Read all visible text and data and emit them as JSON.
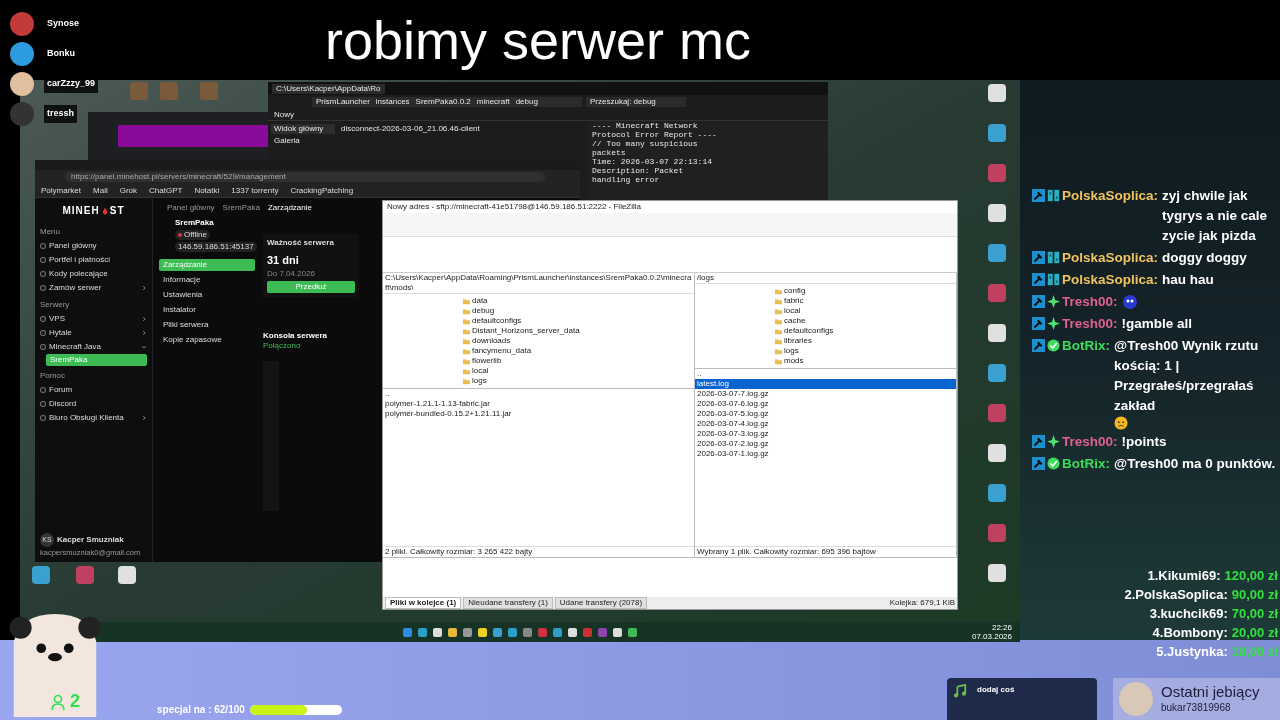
{
  "title": "robimy serwer mc",
  "viewers": [
    {
      "name": "Synose",
      "color": "#c23a3a"
    },
    {
      "name": "Bonku",
      "color": "#2d9be0"
    },
    {
      "name": "carZzzy_99",
      "color": "#e0c0a0"
    },
    {
      "name": "tressh",
      "color": "#333333"
    }
  ],
  "chat": [
    {
      "kind": "bg",
      "user": "PolskaSoplica:",
      "color": "#f0c45c",
      "text": "zyj chwile jak tygrys a nie cale zycie jak pizda"
    },
    {
      "kind": "bg",
      "user": "PolskaSoplica:",
      "color": "#f0c45c",
      "text": "doggy doggy"
    },
    {
      "kind": "bg",
      "user": "PolskaSoplica:",
      "color": "#f0c45c",
      "text": "hau hau"
    },
    {
      "kind": "sparkle",
      "user": "Tresh00:",
      "color": "#e0628f",
      "emote": true
    },
    {
      "kind": "sparkle",
      "user": "Tresh00:",
      "color": "#e0628f",
      "text": "!gamble all"
    },
    {
      "kind": "verified",
      "user": "BotRix:",
      "color": "#3ddc5a",
      "text": "@Tresh00 Wynik rzutu kością: 1 | Przegrałeś/przegrałaś zakład",
      "emoji": true
    },
    {
      "kind": "sparkle",
      "user": "Tresh00:",
      "color": "#e0628f",
      "text": "!points"
    },
    {
      "kind": "verified",
      "user": "BotRix:",
      "color": "#3ddc5a",
      "text": "@Tresh00 ma 0 punktów."
    }
  ],
  "leaderboard": [
    {
      "entry": "1.Kikumi69:",
      "amount": "120,00 zł"
    },
    {
      "entry": "2.PolskaSoplica:",
      "amount": "90,00 zł"
    },
    {
      "entry": "3.kuchcik69:",
      "amount": "70,00 zł"
    },
    {
      "entry": "4.Bombony:",
      "amount": "20,00 zł"
    },
    {
      "entry": "5.Justynka:",
      "amount": "18,00 zł"
    }
  ],
  "viewer_count": "2",
  "goal": {
    "label": "specjal na : 62/100",
    "level": 0.62
  },
  "music_widget": {
    "title": "dodaj coś"
  },
  "last_follower": {
    "title": "Ostatni jebiący",
    "name": "bukar73819968"
  },
  "explorer": {
    "tab": "C:\\Users\\Kacper\\AppData\\Ro",
    "path": [
      "PrismLauncher",
      "instances",
      "SremPaka0.0.2",
      "minecraft",
      "debug"
    ],
    "search": "Przeszukaj: debug",
    "new_button": "Nowy",
    "sidebar": [
      "Widok główny",
      "Galeria"
    ],
    "file": "disconnect-2026-03-06_21.06.46-client",
    "preview": "---- Minecraft Network\nProtocol Error Report ----\n// Too many suspicious\npackets\nTime: 2026-03-07 22:13:14\nDescription: Packet\nhandling error"
  },
  "browser": {
    "url": "https://panel.minehost.pl/servers/minecraft/529/management",
    "bookmarks": [
      "Polymarket",
      "Mail",
      "Grok",
      "ChatGPT",
      "Notatki",
      "1337 torrenty",
      "CrackingPatching"
    ],
    "logo_left": "MINEH",
    "logo_right": "ST",
    "breadcrumb": [
      "Panel główny",
      "SremPaka",
      "Zarządzanie"
    ],
    "server": {
      "name": "SremPaka",
      "status": "Offline",
      "online": false,
      "address": "146.59.186.51:45137"
    },
    "sections": [
      {
        "heading": "Menu",
        "items": [
          {
            "label": "Panel główny"
          },
          {
            "label": "Portfel i płatności"
          },
          {
            "label": "Kody polecające"
          },
          {
            "label": "Zamów serwer",
            "expanded": false
          }
        ]
      },
      {
        "heading": "Serwery",
        "items": [
          {
            "label": "VPS",
            "expanded": false
          },
          {
            "label": "Hytale",
            "expanded": false
          },
          {
            "label": "Minecraft Java",
            "expanded": true,
            "children": [
              {
                "label": "SremPaka",
                "selected": true
              }
            ]
          }
        ]
      },
      {
        "heading": "Pomoc",
        "items": [
          {
            "label": "Forum"
          },
          {
            "label": "Discord"
          },
          {
            "label": "Biuro Obsługi Klienta",
            "expanded": false
          }
        ]
      }
    ],
    "server_nav": [
      {
        "label": "Zarządzanie",
        "selected": true
      },
      {
        "label": "Informacje",
        "selected": false
      },
      {
        "label": "Ustawienia",
        "selected": false
      },
      {
        "label": "Instalator",
        "selected": false
      },
      {
        "label": "Pliki serwera",
        "selected": false
      },
      {
        "label": "Kopie zapasowe",
        "selected": false
      }
    ],
    "validity": {
      "title": "Ważność serwera",
      "days": "31 dni",
      "until": "Do 7.04.2026",
      "button": "Przedłuż"
    },
    "console": {
      "title": "Konsola serwera",
      "status": "Połączono"
    },
    "user": {
      "initials": "KS",
      "name": "Kacper Smuzniak",
      "email": "kacpersmuzniak0@gmail.com"
    }
  },
  "filezilla": {
    "title": "Nowy adres - sftp://minecraft-41e51798@146.59.186.51:2222 - FileZilla",
    "local_path": "C:\\Users\\Kacper\\AppData\\Roaming\\PrismLauncher\\instances\\SremPaka0.0.2\\minecraft\\mods\\",
    "remote_path": "/logs",
    "local_tree": [
      "data",
      "debug",
      "defaultconfigs",
      "Distant_Horizons_server_data",
      "downloads",
      "fancymenu_data",
      "flowerlib",
      "local",
      "logs"
    ],
    "remote_tree": [
      "config",
      "fabric",
      "local",
      "cache",
      "defaultconfigs",
      "libraries",
      "logs",
      "mods"
    ],
    "local_files": [
      {
        "name": "..",
        "selected": false
      },
      {
        "name": "polymer-1.21.1-1.13-fabric.jar",
        "selected": false
      },
      {
        "name": "polymer-bundled-0.15.2+1.21.11.jar",
        "selected": false
      }
    ],
    "remote_files": [
      {
        "name": "..",
        "selected": false
      },
      {
        "name": "latest.log",
        "selected": true
      },
      {
        "name": "2026-03-07-7.log.gz",
        "selected": false
      },
      {
        "name": "2026-03-07-6.log.gz",
        "selected": false
      },
      {
        "name": "2026-03-07-5.log.gz",
        "selected": false
      },
      {
        "name": "2026-03-07-4.log.gz",
        "selected": false
      },
      {
        "name": "2026-03-07-3.log.gz",
        "selected": false
      },
      {
        "name": "2026-03-07-2.log.gz",
        "selected": false
      },
      {
        "name": "2026-03-07-1.log.gz",
        "selected": false
      }
    ],
    "local_summary": "2 pliki. Całkowity rozmiar: 3 265 422 bajty",
    "remote_summary": "Wybrany 1 plik. Całkowity rozmiar: 695 396 bajtów",
    "queue_tabs": [
      {
        "label": "Pliki w kolejce (1)",
        "selected": true
      },
      {
        "label": "Nieudane transfery (1)",
        "selected": false
      },
      {
        "label": "Udane transfery (2078)",
        "selected": false
      }
    ],
    "queue_status": "Kolejka: 679,1 KiB"
  },
  "clock": {
    "time": "22:26",
    "date": "07.03.2026"
  }
}
